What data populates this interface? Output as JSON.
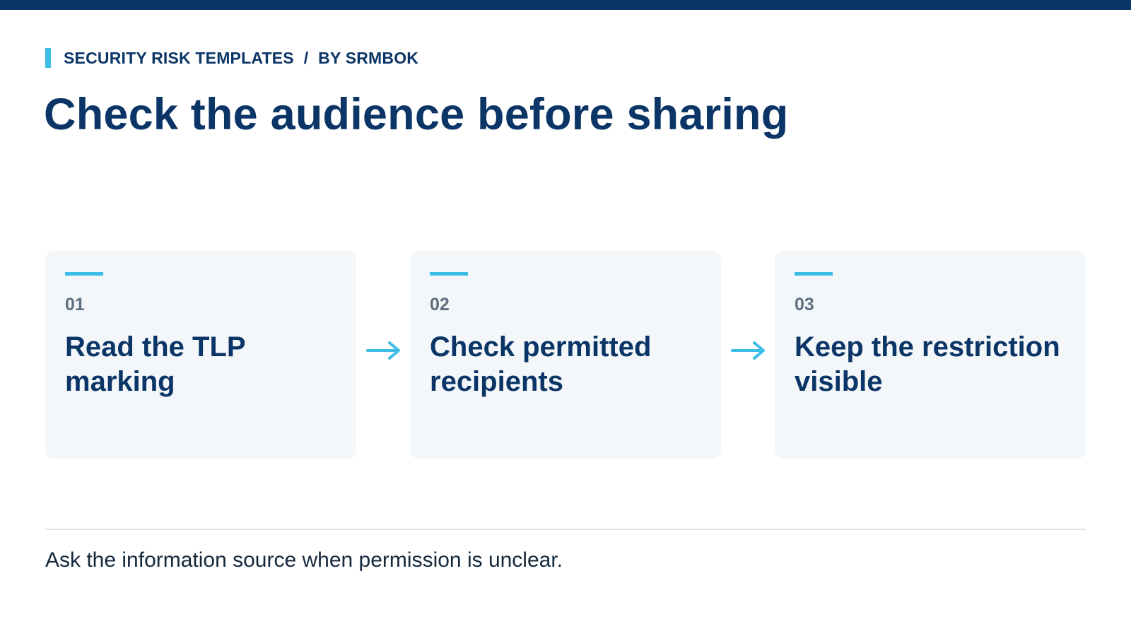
{
  "header": {
    "eyebrow_label": "SECURITY RISK TEMPLATES",
    "eyebrow_separator": "/",
    "eyebrow_author": "BY SRMBOK",
    "title": "Check the audience before sharing"
  },
  "steps": [
    {
      "number": "01",
      "title": "Read the TLP marking"
    },
    {
      "number": "02",
      "title": "Check permitted recipients"
    },
    {
      "number": "03",
      "title": "Keep the restriction visible"
    }
  ],
  "footer": {
    "note": "Ask the information source when permission is unclear."
  },
  "colors": {
    "navy": "#0b3566",
    "accent": "#3bbde6",
    "card_bg": "#f3f7fa",
    "muted": "#5d6f80"
  },
  "icons": {
    "step_connector": "arrow-right-icon"
  }
}
